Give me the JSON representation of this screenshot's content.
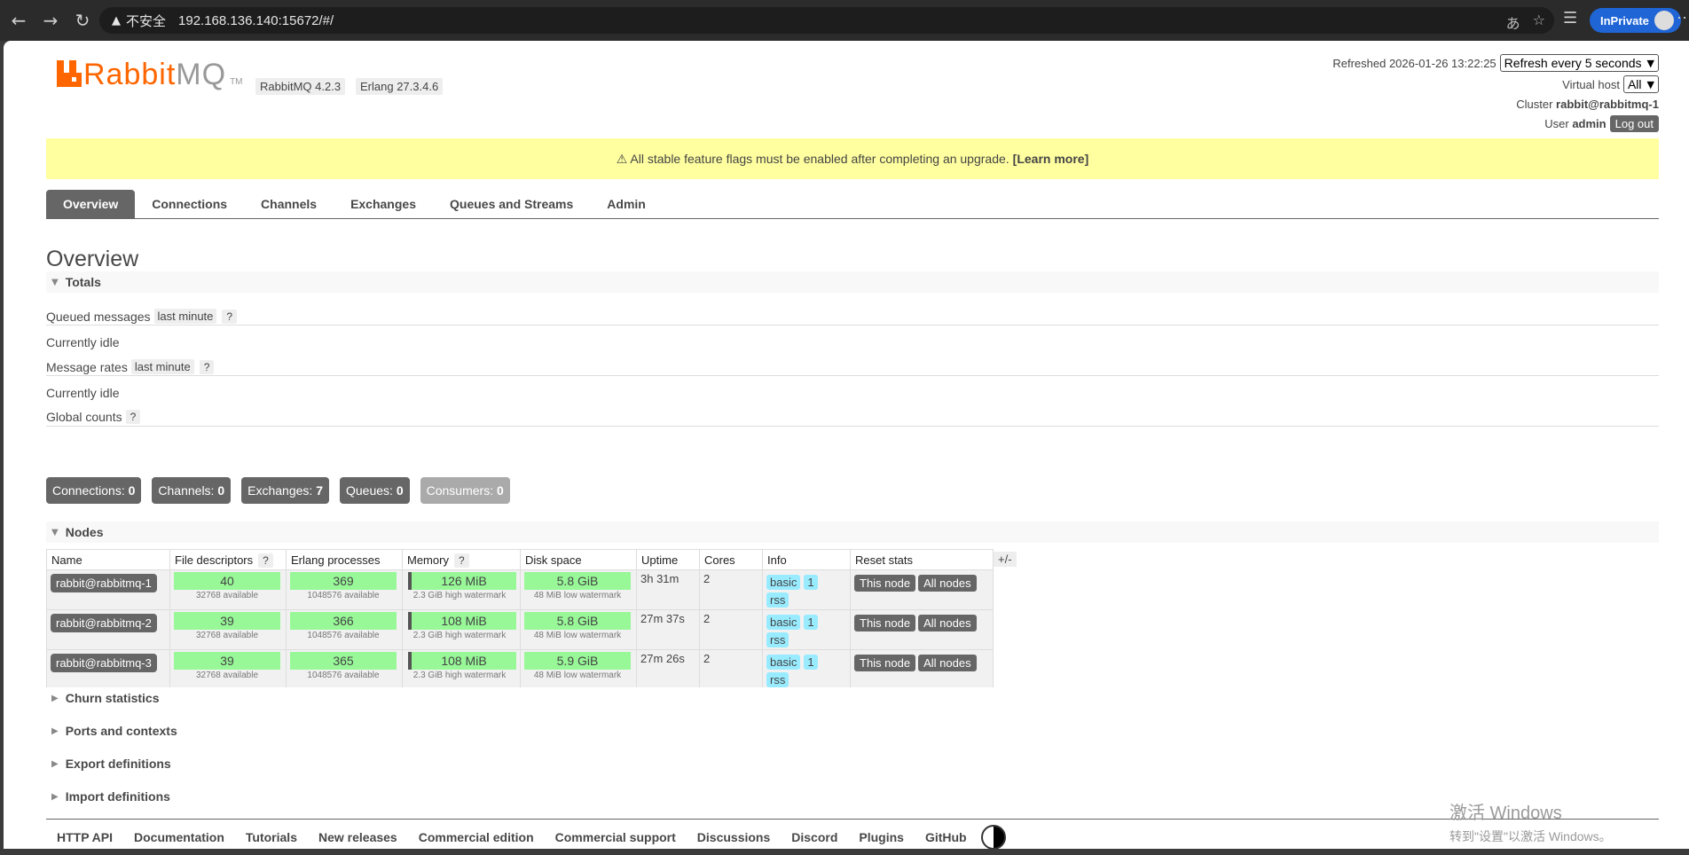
{
  "browser": {
    "back_icon": "←",
    "forward_icon": "→",
    "reload_icon": "↻",
    "insecure_label": "不安全",
    "url": "192.168.136.140:15672/#/",
    "inprivate_label": "InPrivate"
  },
  "header": {
    "logo_rabbit": "Rabbit",
    "logo_mq": "MQ",
    "logo_tm": "TM",
    "rabbitmq_version": "RabbitMQ 4.2.3",
    "erlang_version": "Erlang 27.3.4.6",
    "refreshed_label": "Refreshed 2026-01-26 13:22:25",
    "refresh_select": "Refresh every 5 seconds",
    "virtual_host_label": "Virtual host",
    "virtual_host_select": "All",
    "cluster_label": "Cluster",
    "cluster_name": "rabbit@rabbitmq-1",
    "user_label": "User",
    "user_name": "admin",
    "logout_label": "Log out"
  },
  "banner": {
    "text": "⚠ All stable feature flags must be enabled after completing an upgrade.",
    "link": "[Learn more]"
  },
  "tabs": [
    "Overview",
    "Connections",
    "Channels",
    "Exchanges",
    "Queues and Streams",
    "Admin"
  ],
  "page_title": "Overview",
  "totals": {
    "heading": "Totals",
    "queued_messages_label": "Queued messages",
    "queued_range": "last minute",
    "help": "?",
    "queued_status": "Currently idle",
    "message_rates_label": "Message rates",
    "rates_range": "last minute",
    "rates_status": "Currently idle",
    "global_counts_label": "Global counts",
    "counts": [
      {
        "label": "Connections:",
        "value": "0"
      },
      {
        "label": "Channels:",
        "value": "0"
      },
      {
        "label": "Exchanges:",
        "value": "7"
      },
      {
        "label": "Queues:",
        "value": "0"
      },
      {
        "label": "Consumers:",
        "value": "0"
      }
    ]
  },
  "nodes": {
    "heading": "Nodes",
    "columns": [
      "Name",
      "File descriptors",
      "Erlang processes",
      "Memory",
      "Disk space",
      "Uptime",
      "Cores",
      "Info",
      "Reset stats"
    ],
    "plus_minus": "+/-",
    "rows": [
      {
        "name": "rabbit@rabbitmq-1",
        "fd": "40",
        "fd_sub": "32768 available",
        "procs": "369",
        "procs_sub": "1048576 available",
        "mem": "126 MiB",
        "mem_sub": "2.3 GiB high watermark",
        "disk": "5.8 GiB",
        "disk_sub": "48 MiB low watermark",
        "uptime": "3h 31m",
        "cores": "2",
        "info": [
          "basic",
          "1",
          "rss"
        ],
        "reset": [
          "This node",
          "All nodes"
        ]
      },
      {
        "name": "rabbit@rabbitmq-2",
        "fd": "39",
        "fd_sub": "32768 available",
        "procs": "366",
        "procs_sub": "1048576 available",
        "mem": "108 MiB",
        "mem_sub": "2.3 GiB high watermark",
        "disk": "5.8 GiB",
        "disk_sub": "48 MiB low watermark",
        "uptime": "27m 37s",
        "cores": "2",
        "info": [
          "basic",
          "1",
          "rss"
        ],
        "reset": [
          "This node",
          "All nodes"
        ]
      },
      {
        "name": "rabbit@rabbitmq-3",
        "fd": "39",
        "fd_sub": "32768 available",
        "procs": "365",
        "procs_sub": "1048576 available",
        "mem": "108 MiB",
        "mem_sub": "2.3 GiB high watermark",
        "disk": "5.9 GiB",
        "disk_sub": "48 MiB low watermark",
        "uptime": "27m 26s",
        "cores": "2",
        "info": [
          "basic",
          "1",
          "rss"
        ],
        "reset": [
          "This node",
          "All nodes"
        ]
      }
    ]
  },
  "collapsed_sections": [
    "Churn statistics",
    "Ports and contexts",
    "Export definitions",
    "Import definitions"
  ],
  "footer_links": [
    "HTTP API",
    "Documentation",
    "Tutorials",
    "New releases",
    "Commercial edition",
    "Commercial support",
    "Discussions",
    "Discord",
    "Plugins",
    "GitHub"
  ],
  "watermark": {
    "line1": "激活 Windows",
    "line2": "转到\"设置\"以激活 Windows。"
  }
}
